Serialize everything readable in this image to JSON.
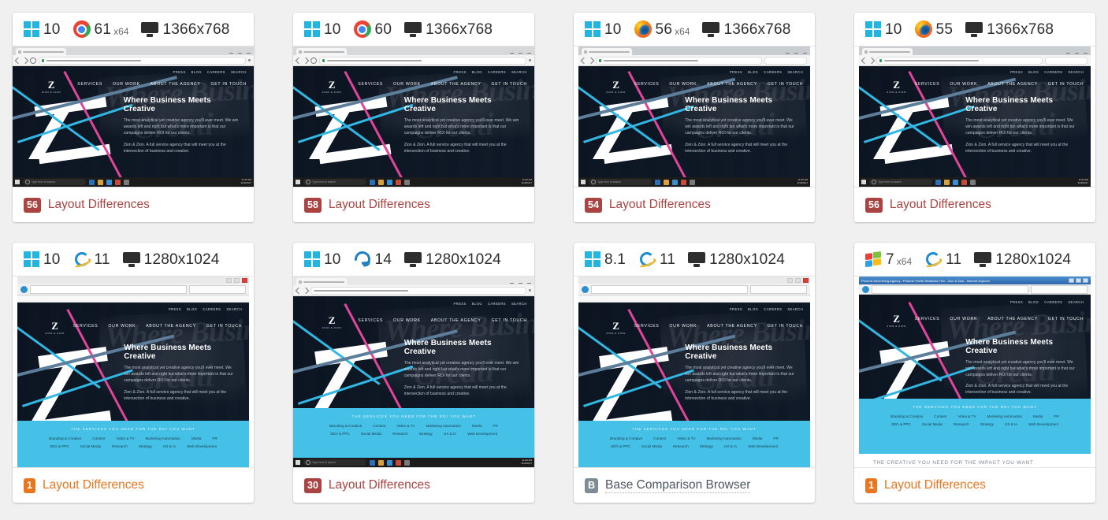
{
  "page": {
    "background_color": "#f0f0f0",
    "accent_red": "#a94442",
    "accent_orange": "#e8761f",
    "accent_gray": "#7f8c96"
  },
  "site": {
    "logo_letter": "Z",
    "logo_sub": "ZION & ZION",
    "top_nav": [
      "PRESS",
      "BLOG",
      "CAREERS",
      "SEARCH"
    ],
    "main_nav": [
      "SERVICES",
      "OUR WORK",
      "ABOUT THE AGENCY",
      "GET IN TOUCH"
    ],
    "hero_heading": "Where Business Meets Creative",
    "hero_paragraph_1": "The most analytical yet creative agency you'll ever meet. We win awards left and right but what's more important is that our campaigns deliver ROI for our clients.",
    "hero_paragraph_2": "Zion & Zion. A full service agency that will meet you at the intersection of business and creative.",
    "services_heading": "THE SERVICES YOU NEED FOR THE ROI YOU WANT",
    "services_row_1": [
      "Branding & Creative",
      "Content",
      "Video & TV",
      "Marketing Automation",
      "Media",
      "PR"
    ],
    "services_row_2": [
      "SEO & PPC",
      "Social Media",
      "Research",
      "Strategy",
      "UX & IA",
      "Web Development"
    ],
    "creative_heading": "THE CREATIVE YOU NEED FOR THE IMPACT YOU WANT",
    "taskbar_search_placeholder": "Type here to search",
    "taskbar_clock_time": "11:06 AM",
    "taskbar_clock_date": "9/18/2017"
  },
  "cards": [
    {
      "os_icon": "windows-10-icon",
      "os_version": "10",
      "os_suffix": "",
      "browser_icon": "chrome-icon",
      "browser_version": "61",
      "browser_suffix": "x64",
      "resolution_icon": "monitor-icon",
      "resolution": "1366x768",
      "badge_value": "56",
      "badge_style": "red",
      "status_label": "Layout Differences",
      "chrome_style": "chrome",
      "layout": "hero"
    },
    {
      "os_icon": "windows-10-icon",
      "os_version": "10",
      "os_suffix": "",
      "browser_icon": "chrome-icon",
      "browser_version": "60",
      "browser_suffix": "",
      "resolution_icon": "monitor-icon",
      "resolution": "1366x768",
      "badge_value": "58",
      "badge_style": "red",
      "status_label": "Layout Differences",
      "chrome_style": "chrome",
      "layout": "hero"
    },
    {
      "os_icon": "windows-10-icon",
      "os_version": "10",
      "os_suffix": "",
      "browser_icon": "firefox-icon",
      "browser_version": "56",
      "browser_suffix": "x64",
      "resolution_icon": "monitor-icon",
      "resolution": "1366x768",
      "badge_value": "54",
      "badge_style": "red",
      "status_label": "Layout Differences",
      "chrome_style": "firefox",
      "layout": "hero"
    },
    {
      "os_icon": "windows-10-icon",
      "os_version": "10",
      "os_suffix": "",
      "browser_icon": "firefox-icon",
      "browser_version": "55",
      "browser_suffix": "",
      "resolution_icon": "monitor-icon",
      "resolution": "1366x768",
      "badge_value": "56",
      "badge_style": "red",
      "status_label": "Layout Differences",
      "chrome_style": "firefox",
      "layout": "hero"
    },
    {
      "os_icon": "windows-10-icon",
      "os_version": "10",
      "os_suffix": "",
      "browser_icon": "internet-explorer-icon",
      "browser_version": "11",
      "browser_suffix": "",
      "resolution_icon": "monitor-icon",
      "resolution": "1280x1024",
      "badge_value": "1",
      "badge_style": "orange",
      "status_label": "Layout Differences",
      "chrome_style": "ie",
      "layout": "tall"
    },
    {
      "os_icon": "windows-10-icon",
      "os_version": "10",
      "os_suffix": "",
      "browser_icon": "edge-icon",
      "browser_version": "14",
      "browser_suffix": "",
      "resolution_icon": "monitor-icon",
      "resolution": "1280x1024",
      "badge_value": "30",
      "badge_style": "red",
      "status_label": "Layout Differences",
      "chrome_style": "edge",
      "layout": "tall-taskbar"
    },
    {
      "os_icon": "windows-81-icon",
      "os_version": "8.1",
      "os_suffix": "",
      "browser_icon": "internet-explorer-icon",
      "browser_version": "11",
      "browser_suffix": "",
      "resolution_icon": "monitor-icon",
      "resolution": "1280x1024",
      "badge_value": "B",
      "badge_style": "gray",
      "status_label": "Base Comparison Browser",
      "chrome_style": "ie",
      "layout": "tall"
    },
    {
      "os_icon": "windows-7-icon",
      "os_version": "7",
      "os_suffix": "x64",
      "browser_icon": "internet-explorer-icon",
      "browser_version": "11",
      "browser_suffix": "",
      "resolution_icon": "monitor-icon",
      "resolution": "1280x1024",
      "badge_value": "1",
      "badge_style": "orange",
      "status_label": "Layout Differences",
      "chrome_style": "win7",
      "layout": "tall-creative",
      "window_title": "Phoenix Advertising Agency - Phoenix Public Relations Firm - Zion & Zion - Internet Explorer"
    }
  ]
}
